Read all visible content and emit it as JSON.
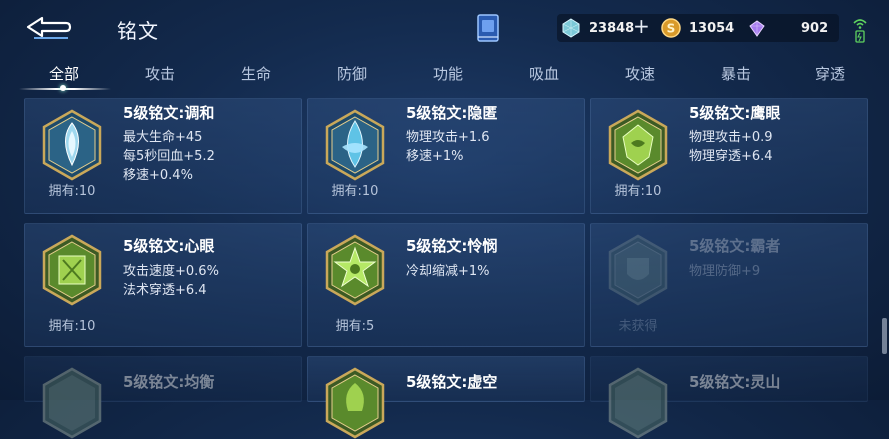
{
  "header": {
    "title": "铭文",
    "currency": [
      {
        "icon": "diamond-icon",
        "value": "23848"
      },
      {
        "icon": "gold-coin-icon",
        "value": "13054"
      },
      {
        "icon": "crystal-icon",
        "value": "902"
      }
    ],
    "plus": "+"
  },
  "tabs": [
    "全部",
    "攻击",
    "生命",
    "防御",
    "功能",
    "吸血",
    "攻速",
    "暴击",
    "穿透"
  ],
  "cards": [
    {
      "name": "5级铭文:调和",
      "attrs": [
        "最大生命+45",
        "每5秒回血+5.2",
        "移速+0.4%"
      ],
      "owned": "拥有:10"
    },
    {
      "name": "5级铭文:隐匿",
      "attrs": [
        "物理攻击+1.6",
        "移速+1%"
      ],
      "owned": "拥有:10"
    },
    {
      "name": "5级铭文:鹰眼",
      "attrs": [
        "物理攻击+0.9",
        "物理穿透+6.4"
      ],
      "owned": "拥有:10"
    },
    {
      "name": "5级铭文:心眼",
      "attrs": [
        "攻击速度+0.6%",
        "法术穿透+6.4"
      ],
      "owned": "拥有:10"
    },
    {
      "name": "5级铭文:怜悯",
      "attrs": [
        "冷却缩减+1%"
      ],
      "owned": "拥有:5"
    },
    {
      "name": "5级铭文:霸者",
      "attrs": [
        "物理防御+9"
      ],
      "owned": "未获得"
    },
    {
      "name": "5级铭文:均衡",
      "attrs": [],
      "owned": ""
    },
    {
      "name": "5级铭文:虚空",
      "attrs": [],
      "owned": ""
    },
    {
      "name": "5级铭文:灵山",
      "attrs": [],
      "owned": ""
    }
  ],
  "colors": {
    "teal": "#8fd6e6",
    "green": "#8fd14f",
    "gold": "#c9a85a"
  }
}
